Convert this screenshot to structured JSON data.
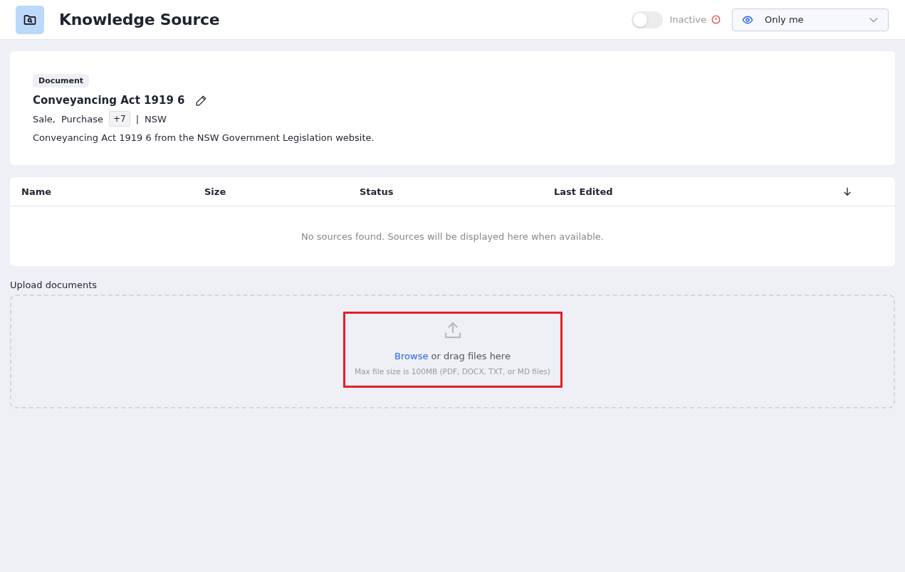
{
  "header": {
    "title": "Knowledge Source",
    "toggle": {
      "on": false,
      "label": "Inactive"
    },
    "visibility": {
      "value": "Only me"
    }
  },
  "document": {
    "badge": "Document",
    "title": "Conveyancing Act 1919 6",
    "tags": [
      "Sale,",
      "Purchase"
    ],
    "more": "+7",
    "separator": "|",
    "region": "NSW",
    "description": "Conveyancing Act 1919 6 from the NSW Government Legislation website."
  },
  "table": {
    "columns": [
      "Name",
      "Size",
      "Status",
      "Last Edited"
    ],
    "empty_message": "No sources found. Sources will be displayed here when available."
  },
  "upload": {
    "label": "Upload documents",
    "link": "Browse",
    "text": "or drag files here",
    "hint": "Max file size is 100MB (PDF, DOCX, TXT, or MD files)"
  }
}
